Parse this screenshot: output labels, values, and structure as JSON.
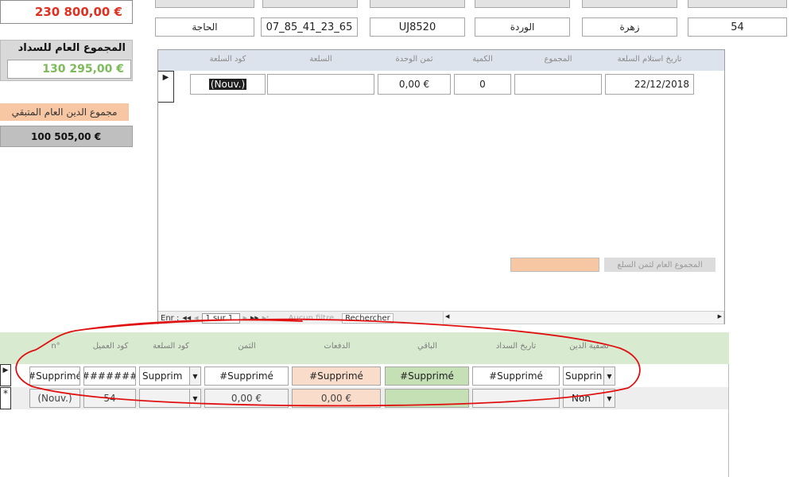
{
  "left_panel": {
    "total_amount": "230 800,00 €",
    "paid_title": "المجموع العام للسداد",
    "paid_value": "130 295,00 €",
    "debt_title": "مجموع الدين العام المتبقي",
    "debt_value": "100 505,00 €"
  },
  "top_fields": [
    "الحاجة",
    "07_85_41_23_65",
    "UJ8520",
    "الوردة",
    "زهرة",
    "54"
  ],
  "upper_grid": {
    "headers": [
      "تاريخ استلام السلعة",
      "المجموع",
      "الكمية",
      "ثمن الوحدة",
      "السلعة",
      "كود السلعة"
    ],
    "row": {
      "date": "22/12/2018",
      "total": "",
      "qty": "0",
      "unit_price": "0,00 €",
      "product": "",
      "code": "(Nouv.)"
    },
    "total_label": "المجموع العام لثمن السلع",
    "total_value": "",
    "nav": {
      "record_label": "Enr :",
      "first": "◀◀",
      "prev": "◀",
      "position": "1 sur 1",
      "next": "▶",
      "last": "▶▶",
      "new": "▶*",
      "filter": "Aucun filtre",
      "search": "Rechercher"
    }
  },
  "lower_grid": {
    "headers": [
      "n°",
      "كود العميل",
      "كود السلعة",
      "الثمن",
      "الدفعات",
      "الباقي",
      "تاريخ السداد",
      "تصفية الدين"
    ],
    "row1": {
      "n": "#Supprimé",
      "client": "#######",
      "product": "Supprim",
      "price": "#Supprimé",
      "payments": "#Supprimé",
      "remaining": "#Supprimé",
      "date": "#Supprimé",
      "settle": "Supprin"
    },
    "row2": {
      "n": "(Nouv.)",
      "client": "54",
      "product": "",
      "price": "0,00 €",
      "payments": "0,00 €",
      "remaining": "",
      "date": "",
      "settle": "Non"
    },
    "row_markers": [
      "▶",
      "*"
    ]
  },
  "colors": {
    "accent_red": "#e03020",
    "green_text": "#7dbb5a",
    "salmon": "#f7c6a3",
    "green_cell": "#c4e0b4",
    "header_green": "#d8ead0",
    "annotation": "#e01010"
  }
}
